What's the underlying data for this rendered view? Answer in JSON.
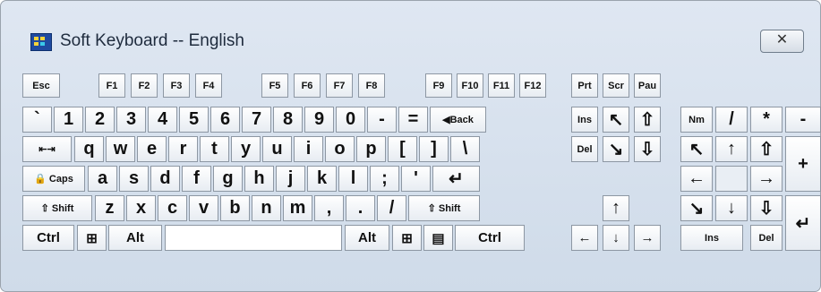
{
  "window": {
    "title": "Soft Keyboard -- English",
    "close_glyph": "✕"
  },
  "rows": {
    "fn": [
      {
        "name": "key-esc",
        "label": "Esc"
      },
      {
        "name": "key-f1",
        "label": "F1"
      },
      {
        "name": "key-f2",
        "label": "F2"
      },
      {
        "name": "key-f3",
        "label": "F3"
      },
      {
        "name": "key-f4",
        "label": "F4"
      },
      {
        "name": "key-f5",
        "label": "F5"
      },
      {
        "name": "key-f6",
        "label": "F6"
      },
      {
        "name": "key-f7",
        "label": "F7"
      },
      {
        "name": "key-f8",
        "label": "F8"
      },
      {
        "name": "key-f9",
        "label": "F9"
      },
      {
        "name": "key-f10",
        "label": "F10"
      },
      {
        "name": "key-f11",
        "label": "F11"
      },
      {
        "name": "key-f12",
        "label": "F12"
      },
      {
        "name": "key-prtsc",
        "label": "Prt"
      },
      {
        "name": "key-scrlk",
        "label": "Scr"
      },
      {
        "name": "key-pause",
        "label": "Pau"
      }
    ],
    "number": [
      {
        "name": "key-backtick",
        "label": "`"
      },
      {
        "name": "key-1",
        "label": "1"
      },
      {
        "name": "key-2",
        "label": "2"
      },
      {
        "name": "key-3",
        "label": "3"
      },
      {
        "name": "key-4",
        "label": "4"
      },
      {
        "name": "key-5",
        "label": "5"
      },
      {
        "name": "key-6",
        "label": "6"
      },
      {
        "name": "key-7",
        "label": "7"
      },
      {
        "name": "key-8",
        "label": "8"
      },
      {
        "name": "key-9",
        "label": "9"
      },
      {
        "name": "key-0",
        "label": "0"
      },
      {
        "name": "key-minus",
        "label": "-"
      },
      {
        "name": "key-equals",
        "label": "="
      },
      {
        "name": "key-backspace",
        "label": "◀Back"
      },
      {
        "name": "key-insert",
        "label": "Ins"
      },
      {
        "name": "key-home",
        "label": "↖"
      },
      {
        "name": "key-pageup",
        "label": "⇧"
      },
      {
        "name": "key-numlock",
        "label": "Nm"
      },
      {
        "name": "key-num-divide",
        "label": "/"
      },
      {
        "name": "key-num-multiply",
        "label": "*"
      },
      {
        "name": "key-num-minus",
        "label": "-"
      }
    ],
    "qwerty": [
      {
        "name": "key-tab",
        "label": "⇤⇥"
      },
      {
        "name": "key-q",
        "label": "q"
      },
      {
        "name": "key-w",
        "label": "w"
      },
      {
        "name": "key-e",
        "label": "e"
      },
      {
        "name": "key-r",
        "label": "r"
      },
      {
        "name": "key-t",
        "label": "t"
      },
      {
        "name": "key-y",
        "label": "y"
      },
      {
        "name": "key-u",
        "label": "u"
      },
      {
        "name": "key-i",
        "label": "i"
      },
      {
        "name": "key-o",
        "label": "o"
      },
      {
        "name": "key-p",
        "label": "p"
      },
      {
        "name": "key-lbracket",
        "label": "["
      },
      {
        "name": "key-rbracket",
        "label": "]"
      },
      {
        "name": "key-backslash",
        "label": "\\"
      },
      {
        "name": "key-delete",
        "label": "Del"
      },
      {
        "name": "key-end",
        "label": "↘"
      },
      {
        "name": "key-pagedown",
        "label": "⇩"
      },
      {
        "name": "key-num-7",
        "label": "↖"
      },
      {
        "name": "key-num-8",
        "label": "↑"
      },
      {
        "name": "key-num-9",
        "label": "⇧"
      },
      {
        "name": "key-num-plus",
        "label": "+"
      }
    ],
    "home": [
      {
        "name": "key-capslock",
        "label": "🔒 Caps"
      },
      {
        "name": "key-a",
        "label": "a"
      },
      {
        "name": "key-s",
        "label": "s"
      },
      {
        "name": "key-d",
        "label": "d"
      },
      {
        "name": "key-f",
        "label": "f"
      },
      {
        "name": "key-g",
        "label": "g"
      },
      {
        "name": "key-h",
        "label": "h"
      },
      {
        "name": "key-j",
        "label": "j"
      },
      {
        "name": "key-k",
        "label": "k"
      },
      {
        "name": "key-l",
        "label": "l"
      },
      {
        "name": "key-semicolon",
        "label": ";"
      },
      {
        "name": "key-quote",
        "label": "'"
      },
      {
        "name": "key-enter",
        "label": "↵"
      },
      {
        "name": "key-num-4",
        "label": "←"
      },
      {
        "name": "key-num-5",
        "label": ""
      },
      {
        "name": "key-num-6",
        "label": "→"
      }
    ],
    "shift": [
      {
        "name": "key-lshift",
        "label": "⇧ Shift"
      },
      {
        "name": "key-z",
        "label": "z"
      },
      {
        "name": "key-x",
        "label": "x"
      },
      {
        "name": "key-c",
        "label": "c"
      },
      {
        "name": "key-v",
        "label": "v"
      },
      {
        "name": "key-b",
        "label": "b"
      },
      {
        "name": "key-n",
        "label": "n"
      },
      {
        "name": "key-m",
        "label": "m"
      },
      {
        "name": "key-comma",
        "label": ","
      },
      {
        "name": "key-period",
        "label": "."
      },
      {
        "name": "key-slash",
        "label": "/"
      },
      {
        "name": "key-rshift",
        "label": "⇧ Shift"
      },
      {
        "name": "key-up",
        "label": "↑"
      },
      {
        "name": "key-num-1",
        "label": "↘"
      },
      {
        "name": "key-num-2",
        "label": "↓"
      },
      {
        "name": "key-num-3",
        "label": "⇩"
      },
      {
        "name": "key-num-enter",
        "label": "↵"
      }
    ],
    "bottom": [
      {
        "name": "key-lctrl",
        "label": "Ctrl"
      },
      {
        "name": "key-lwin",
        "label": "⊞"
      },
      {
        "name": "key-lalt",
        "label": "Alt"
      },
      {
        "name": "key-space",
        "label": ""
      },
      {
        "name": "key-ralt",
        "label": "Alt"
      },
      {
        "name": "key-rwin",
        "label": "⊞"
      },
      {
        "name": "key-menu",
        "label": "▤"
      },
      {
        "name": "key-rctrl",
        "label": "Ctrl"
      },
      {
        "name": "key-left",
        "label": "←"
      },
      {
        "name": "key-down",
        "label": "↓"
      },
      {
        "name": "key-right",
        "label": "→"
      },
      {
        "name": "key-num-0",
        "label": "Ins"
      },
      {
        "name": "key-num-decimal",
        "label": "Del"
      }
    ]
  }
}
